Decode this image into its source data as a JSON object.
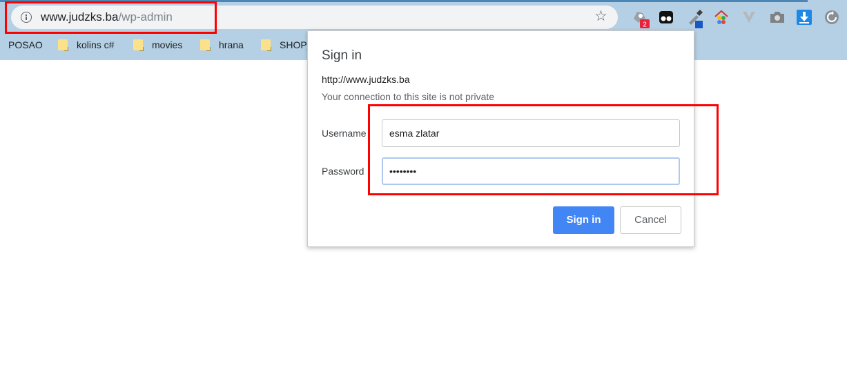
{
  "browser": {
    "url_host": "www.judzks.ba",
    "url_path": "/wp-admin",
    "extensions": [
      {
        "icon": "vpn-extension-icon",
        "badge": "2",
        "badge_color": "#e8223a"
      },
      {
        "icon": "tampermonkey-icon"
      },
      {
        "icon": "color-picker-icon"
      },
      {
        "icon": "home-colors-icon"
      },
      {
        "icon": "v-extension-icon"
      },
      {
        "icon": "camera-icon"
      },
      {
        "icon": "download-icon",
        "color": "#1e88e5"
      },
      {
        "icon": "refresh-icon"
      }
    ]
  },
  "bookmarks": [
    {
      "label": "POSAO",
      "folder": false
    },
    {
      "label": "kolins c#",
      "folder": true
    },
    {
      "label": "movies",
      "folder": true
    },
    {
      "label": "hrana",
      "folder": true
    },
    {
      "label": "SHOP_",
      "folder": true
    }
  ],
  "dialog": {
    "title": "Sign in",
    "url": "http://www.judzks.ba",
    "warning": "Your connection to this site is not private",
    "username_label": "Username",
    "username_value": "esma zlatar",
    "password_label": "Password",
    "password_value": "••••••••",
    "signin_label": "Sign in",
    "cancel_label": "Cancel"
  },
  "colors": {
    "chrome": "#b5d0e4",
    "primary_button": "#4285f4",
    "highlight_box": "#ff0000"
  }
}
